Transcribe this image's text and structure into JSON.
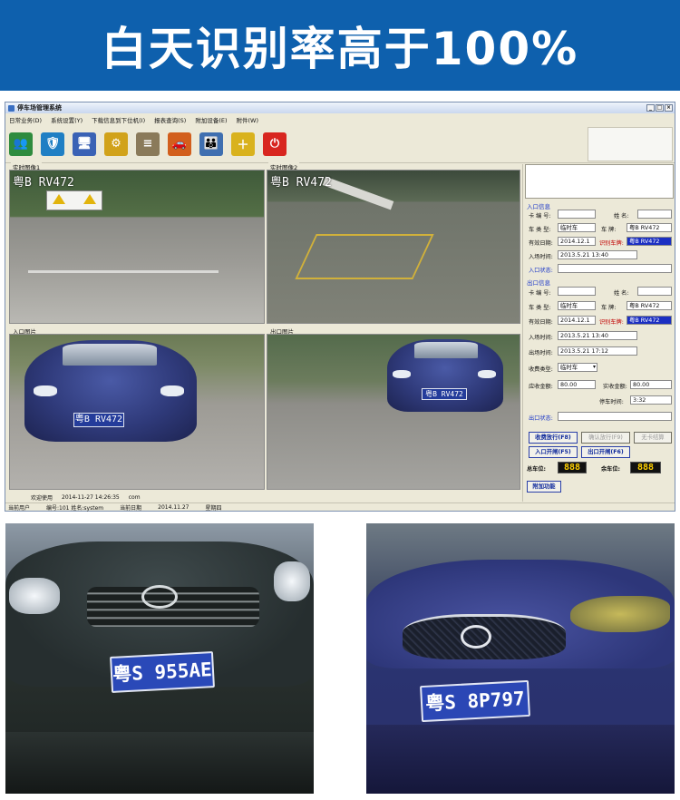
{
  "banner": {
    "text": "白天识别率高于100%"
  },
  "window": {
    "title": "停车场管理系统",
    "controls": [
      "_",
      "□",
      "×"
    ],
    "menu": [
      "日常业务(D)",
      "系统设置(Y)",
      "下载信息到下位机(I)",
      "报表查询(S)",
      "附加设备(E)",
      "附件(W)"
    ],
    "toolbar_icons": [
      {
        "name": "users-icon",
        "glyph": "👥",
        "color": "#2e8b3e"
      },
      {
        "name": "shield-icon",
        "glyph": "🛡",
        "color": "#1f7fc4"
      },
      {
        "name": "monitor-icon",
        "glyph": "🖥",
        "color": "#3a62b5"
      },
      {
        "name": "gear-icon",
        "glyph": "⚙",
        "color": "#d1a21a"
      },
      {
        "name": "database-icon",
        "glyph": "≡",
        "color": "#8a7a5a"
      },
      {
        "name": "car-icon",
        "glyph": "🚗",
        "color": "#d25f1d"
      },
      {
        "name": "group-icon",
        "glyph": "👪",
        "color": "#3f6fb0"
      },
      {
        "name": "add-chart-icon",
        "glyph": "＋",
        "color": "#d9b21d"
      },
      {
        "name": "power-icon",
        "glyph": "⏻",
        "color": "#d8261f"
      }
    ]
  },
  "cameras": {
    "live1": {
      "label": "实时图像1",
      "plate": "粤B RV472"
    },
    "live2": {
      "label": "实时图像2",
      "plate": "粤B RV472"
    },
    "entry": {
      "label": "入口图片",
      "plate": "粤B RV472"
    },
    "exit": {
      "label": "出口图片",
      "plate": "粤B RV472"
    }
  },
  "entry_info": {
    "title": "入口信息",
    "card_no_label": "卡 编 号:",
    "card_no": "",
    "name_label": "姓  名:",
    "name": "",
    "car_type_label": "车 类 型:",
    "car_type": "临时车",
    "plate_label": "车  牌:",
    "plate": "粤B RV472",
    "valid_date_label": "有效日期:",
    "valid_date": "2014.12.1",
    "recognized_plate_label": "识别车牌:",
    "recognized_plate": "粤B RV472",
    "entry_time_label": "入场时间:",
    "entry_time": "2013.5.21    13:40",
    "entry_status_label": "入口状态:",
    "entry_status": ""
  },
  "exit_info": {
    "title": "出口信息",
    "card_no_label": "卡 编 号:",
    "card_no": "",
    "name_label": "姓  名:",
    "name": "",
    "car_type_label": "车 类 型:",
    "car_type": "临时车",
    "plate_label": "车  牌:",
    "plate": "粤B RV472",
    "valid_date_label": "有效日期:",
    "valid_date": "2014.12.1",
    "recognized_plate_label": "识别车牌:",
    "recognized_plate": "粤B RV472",
    "entry_time_label": "入场时间:",
    "entry_time": "2013.5.21    13:40",
    "exit_time_label": "出场时间:",
    "exit_time": "2013.5.21    17:12",
    "fee_type_label": "收费类型:",
    "fee_type": "临时车",
    "due_label": "应收金额:",
    "due": "80.00",
    "paid_label": "实收金额:",
    "paid": "80.00",
    "duration_label": "停车时间:",
    "duration": "3:32",
    "exit_status_label": "出口状态:",
    "exit_status": ""
  },
  "buttons": {
    "charge_release": "收费放行(F8)",
    "confirm_release": "确认放行(F9)",
    "no_card_checkout": "无卡结算",
    "entry_open": "入口开闸(F5)",
    "exit_open": "出口开闸(F6)",
    "extra": "附加功能"
  },
  "counters": {
    "total_label": "总车位:",
    "total": "888",
    "free_label": "余车位:",
    "free": "888"
  },
  "status": {
    "welcome": "欢迎使用",
    "datetime": "2014-11-27 14:26:35",
    "port": "com",
    "user_label": "当前用户",
    "user_info": "编号:101  姓名:system",
    "date_label": "当前日期",
    "date": "2014.11.27",
    "weekday": "星期四"
  },
  "photos": {
    "left_plate": "粤S 955AE",
    "right_plate": "粤S 8P797"
  }
}
